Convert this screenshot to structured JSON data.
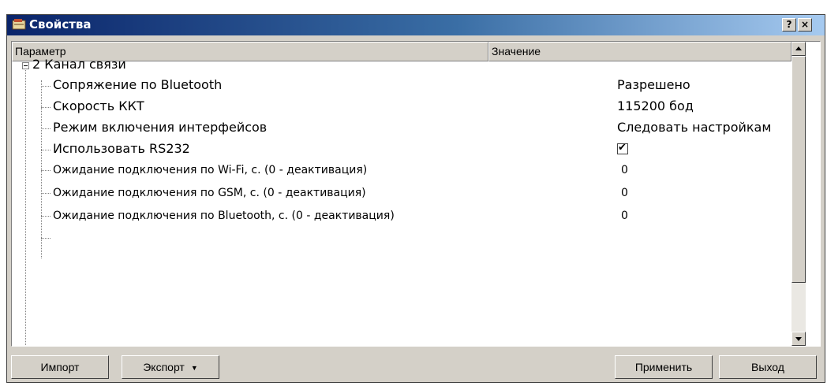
{
  "window": {
    "title": "Свойства",
    "help_label": "?",
    "close_label": "×"
  },
  "grid": {
    "columns": [
      "Параметр",
      "Значение"
    ],
    "group": {
      "label": "2 Канал связи"
    },
    "rows": [
      {
        "label": "Сопряжение по Bluetooth",
        "value": "Разрешено"
      },
      {
        "label": "Скорость ККТ",
        "value": "115200 бод"
      },
      {
        "label": "Режим включения интерфейсов",
        "value": "Следовать настройкам"
      },
      {
        "label": "Использовать RS232",
        "value": "✔"
      },
      {
        "label": "Ожидание подключения по Wi-Fi, с. (0 - деактивация)",
        "value": "0"
      },
      {
        "label": "Ожидание подключения по GSM, с. (0 - деактивация)",
        "value": "0"
      },
      {
        "label": "Ожидание подключения по Bluetooth, с. (0 - деактивация)",
        "value": "0"
      }
    ]
  },
  "footer": {
    "import_label": "Импорт",
    "export_label": "Экспорт",
    "export_arrow": "▼",
    "apply_label": "Применить",
    "exit_label": "Выход"
  },
  "colors": {
    "title_start": "#0a246a",
    "title_end": "#a6caf0",
    "face": "#d4d0c8"
  },
  "icons": [
    "window-icon",
    "help-icon",
    "close-icon",
    "collapse-icon",
    "scroll-up-icon",
    "scroll-down-icon",
    "checkbox-checked-icon",
    "dropdown-arrow-icon"
  ]
}
